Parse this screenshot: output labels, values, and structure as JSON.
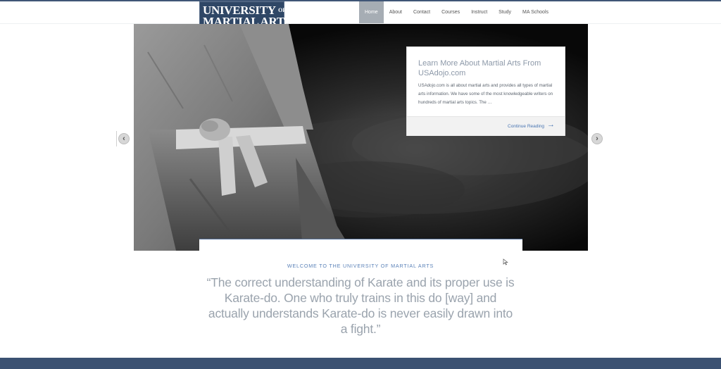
{
  "logo": {
    "line1": "UNIVERSITY",
    "line1_of": "OF",
    "line2": "MARTIAL ARTS"
  },
  "nav": {
    "items": [
      "Home",
      "About",
      "Contact",
      "Courses",
      "Instruct",
      "Study",
      "MA Schools"
    ],
    "active_index": 0
  },
  "slider": {
    "prev_icon": "chevron-left-icon",
    "next_icon": "chevron-right-icon",
    "prev_glyph": "‹",
    "next_glyph": "›"
  },
  "card": {
    "title": "Learn More About Martial Arts From USAdojo.com",
    "body": "USAdojo.com is all about martial arts and provides all types of martial arts information. We have some of the most knowledgeable writers on hundreds of martial arts topics. The …",
    "link": "Continue Reading",
    "link_arrow": "→"
  },
  "welcome": "WELCOME TO THE UNIVERSITY OF MARTIAL ARTS",
  "quote": "“The correct understanding of Karate and its proper use is Karate-do. One who truly trains in this do [way] and actually understands Karate-do is never easily drawn into a fight.”",
  "colors": {
    "brand_navy": "#2f4766",
    "footer": "#3b5172",
    "accent_link": "#4a76b2",
    "nav_active": "#a6adb4"
  }
}
